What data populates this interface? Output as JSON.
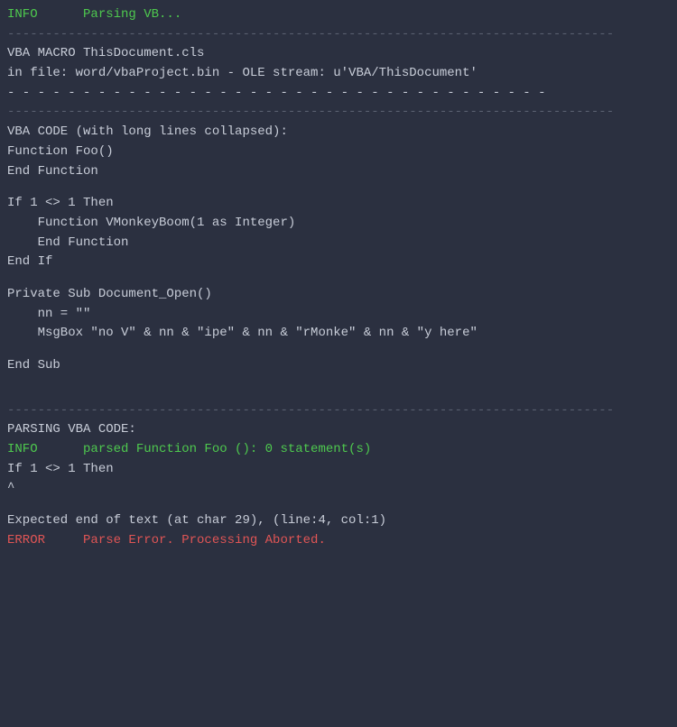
{
  "terminal": {
    "lines": [
      {
        "id": "info-parsing",
        "text": "INFO      Parsing VB...",
        "color": "green"
      },
      {
        "id": "divider1",
        "text": "--------------------------------------------------------------------------------",
        "color": "divider"
      },
      {
        "id": "vba-macro-label",
        "text": "VBA MACRO ThisDocument.cls",
        "color": "white"
      },
      {
        "id": "vba-file-path",
        "text": "in file: word/vbaProject.bin - OLE stream: u'VBA/ThisDocument'",
        "color": "white"
      },
      {
        "id": "dashes",
        "text": "- - - - - - - - - - - - - - - - - - - - - - - - - - - - - - - - - - - -",
        "color": "white"
      },
      {
        "id": "divider2",
        "text": "--------------------------------------------------------------------------------",
        "color": "divider"
      },
      {
        "id": "vba-code-label",
        "text": "VBA CODE (with long lines collapsed):",
        "color": "white"
      },
      {
        "id": "func-foo",
        "text": "Function Foo()",
        "color": "white"
      },
      {
        "id": "end-func1",
        "text": "End Function",
        "color": "white"
      },
      {
        "id": "spacer1",
        "text": "",
        "color": "white"
      },
      {
        "id": "if-1",
        "text": "If 1 <> 1 Then",
        "color": "white"
      },
      {
        "id": "func-vmonkey",
        "text": "    Function VMonkeyBoom(1 as Integer)",
        "color": "white"
      },
      {
        "id": "end-func2",
        "text": "    End Function",
        "color": "white"
      },
      {
        "id": "end-if",
        "text": "End If",
        "color": "white"
      },
      {
        "id": "spacer2",
        "text": "",
        "color": "white"
      },
      {
        "id": "private-sub",
        "text": "Private Sub Document_Open()",
        "color": "white"
      },
      {
        "id": "nn-assign",
        "text": "    nn = \"\"",
        "color": "white"
      },
      {
        "id": "msgbox",
        "text": "    MsgBox \"no V\" & nn & \"ipe\" & nn & \"rMonke\" & nn & \"y here\"",
        "color": "white"
      },
      {
        "id": "spacer3",
        "text": "",
        "color": "white"
      },
      {
        "id": "end-sub",
        "text": "End Sub",
        "color": "white"
      },
      {
        "id": "spacer4",
        "text": "",
        "color": "white"
      },
      {
        "id": "spacer5",
        "text": "",
        "color": "white"
      },
      {
        "id": "divider3",
        "text": "--------------------------------------------------------------------------------",
        "color": "divider"
      },
      {
        "id": "parsing-label",
        "text": "PARSING VBA CODE:",
        "color": "white"
      },
      {
        "id": "info-parsed",
        "text": "INFO      parsed Function Foo (): 0 statement(s)",
        "color": "green"
      },
      {
        "id": "if-1b",
        "text": "If 1 <> 1 Then",
        "color": "white"
      },
      {
        "id": "caret",
        "text": "^",
        "color": "white"
      },
      {
        "id": "spacer6",
        "text": "",
        "color": "white"
      },
      {
        "id": "expected-error",
        "text": "Expected end of text (at char 29), (line:4, col:1)",
        "color": "white"
      },
      {
        "id": "error-line",
        "text": "ERROR     Parse Error. Processing Aborted.",
        "color": "red"
      }
    ]
  }
}
